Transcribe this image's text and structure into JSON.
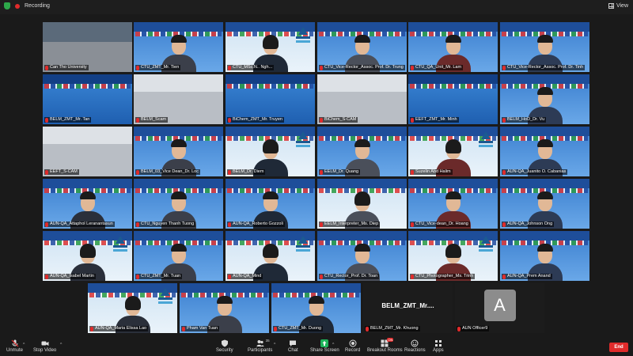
{
  "topbar": {
    "recording_label": "Recording",
    "view_label": "View"
  },
  "tiles": [
    {
      "name": "Can Tho University",
      "kind": "hall"
    },
    {
      "name": "CTU_ZMT_Mr. Tien",
      "kind": "person"
    },
    {
      "name": "CTU_MSc.N.. Ngh...",
      "kind": "person_f"
    },
    {
      "name": "CTU_Vice-Rector_Assoc. Prof. Dr. Trung",
      "kind": "person"
    },
    {
      "name": "CTU_QA_Unit_Mr. Lam",
      "kind": "person"
    },
    {
      "name": "CTU_Vice-Rector_Assoc. Prof. Dr. Tinh",
      "kind": "person"
    },
    {
      "name": "BELM_ZMT_Mr. Tan",
      "kind": "banner"
    },
    {
      "name": "BELM_Scam",
      "kind": "room"
    },
    {
      "name": "BiChem_ZMT_Mr. Truyen",
      "kind": "banner"
    },
    {
      "name": "BiChem_S-CAM",
      "kind": "room"
    },
    {
      "name": "EEFT_ZMT_Mr. Minh",
      "kind": "banner"
    },
    {
      "name": "BELM_HoD_Dr. Vu",
      "kind": "person"
    },
    {
      "name": "EEFT_S-CAM",
      "kind": "room"
    },
    {
      "name": "BELM_03_Vice Dean_Dr. Loc",
      "kind": "person"
    },
    {
      "name": "BELM_Dr. Diem",
      "kind": "person_f"
    },
    {
      "name": "EELM_Dr. Quang",
      "kind": "person"
    },
    {
      "name": "Suzelin Abd Halim",
      "kind": "person_f"
    },
    {
      "name": "AUN-QA_Juanito O. Cabanias",
      "kind": "person"
    },
    {
      "name": "AUN-QA_Attaphol Leranantasun",
      "kind": "person"
    },
    {
      "name": "CTU_Nguyen Thanh Tuong",
      "kind": "person"
    },
    {
      "name": "AUN-QA_Roberto Gozzoli",
      "kind": "person"
    },
    {
      "name": "EELM_Interpreter_Ms. Diep",
      "kind": "person_f"
    },
    {
      "name": "CTU_Vice-dean_Dr. Hoang",
      "kind": "person"
    },
    {
      "name": "AUN-QA_Johnson Ong",
      "kind": "person"
    },
    {
      "name": "AUN-QA_Isabel Martin",
      "kind": "person_f"
    },
    {
      "name": "CTU_ZMT_Mr. Tuan",
      "kind": "person"
    },
    {
      "name": "AUN-QA_Mind",
      "kind": "person_f"
    },
    {
      "name": "CTU_Rector_Prof. Dr. Toan",
      "kind": "person"
    },
    {
      "name": "CTU_Photographer_Ms. Trinh",
      "kind": "person_f"
    },
    {
      "name": "AUN-QA_Prem Anand",
      "kind": "person"
    },
    {
      "name": "AUN-QA_Maria Elissa Lao",
      "kind": "person_f"
    },
    {
      "name": "Pham Van Tuan",
      "kind": "person"
    },
    {
      "name": "CTU_ZMT_Mr. Duong",
      "kind": "person"
    },
    {
      "name": "BELM_ZMT_Mr. Khuong",
      "kind": "named",
      "big": "BELM_ZMT_Mr...."
    },
    {
      "name": "AUN Officer9",
      "kind": "avatar",
      "initial": "A"
    }
  ],
  "toolbar": {
    "unmute": "Unmute",
    "stop_video": "Stop Video",
    "security": "Security",
    "participants": "Participants",
    "participants_count": "35",
    "chat": "Chat",
    "share_screen": "Share Screen",
    "record": "Record",
    "breakout_rooms": "Breakout Rooms",
    "reactions": "Reactions",
    "apps": "Apps",
    "end": "End"
  },
  "colors": {
    "accent_green": "#1cb45a",
    "end_red": "#e02b2b",
    "active_speaker": "#f5d21c"
  }
}
